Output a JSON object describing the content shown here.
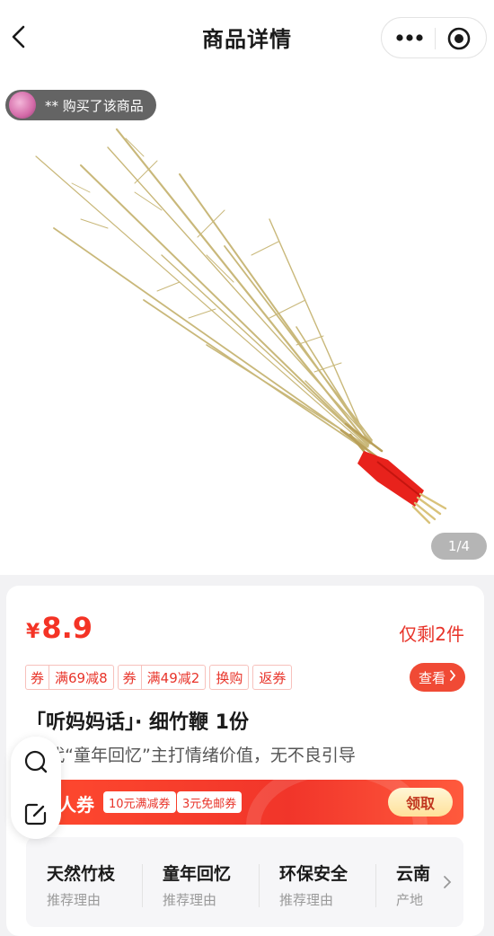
{
  "nav": {
    "title": "商品详情"
  },
  "hero": {
    "buyer_notice": "** 购买了该商品",
    "page_indicator": "1/4"
  },
  "product": {
    "price_currency": "¥",
    "price": "8.9",
    "stock": "仅剩2件",
    "title": "「听妈妈话」· 细竹鞭 1份",
    "description": "90代“童年回忆”主打情绪价值，无不良引导"
  },
  "tags": [
    {
      "prefix": "券",
      "text": "满69减8"
    },
    {
      "prefix": "券",
      "text": "满49减2"
    },
    {
      "prefix": "",
      "text": "换购"
    },
    {
      "prefix": "",
      "text": "返券"
    }
  ],
  "view_button": "查看",
  "coupon": {
    "label": "人券",
    "chips": [
      "10元满减券",
      "3元免邮券"
    ],
    "claim": "领取"
  },
  "reasons": [
    {
      "title": "天然竹枝",
      "sub": "推荐理由"
    },
    {
      "title": "童年回忆",
      "sub": "推荐理由"
    },
    {
      "title": "环保安全",
      "sub": "推荐理由"
    },
    {
      "title": "云南",
      "sub": "产地"
    }
  ],
  "colors": {
    "accent": "#f43325",
    "coupon_bar": "#f1352a",
    "tape": "#e8221c"
  }
}
